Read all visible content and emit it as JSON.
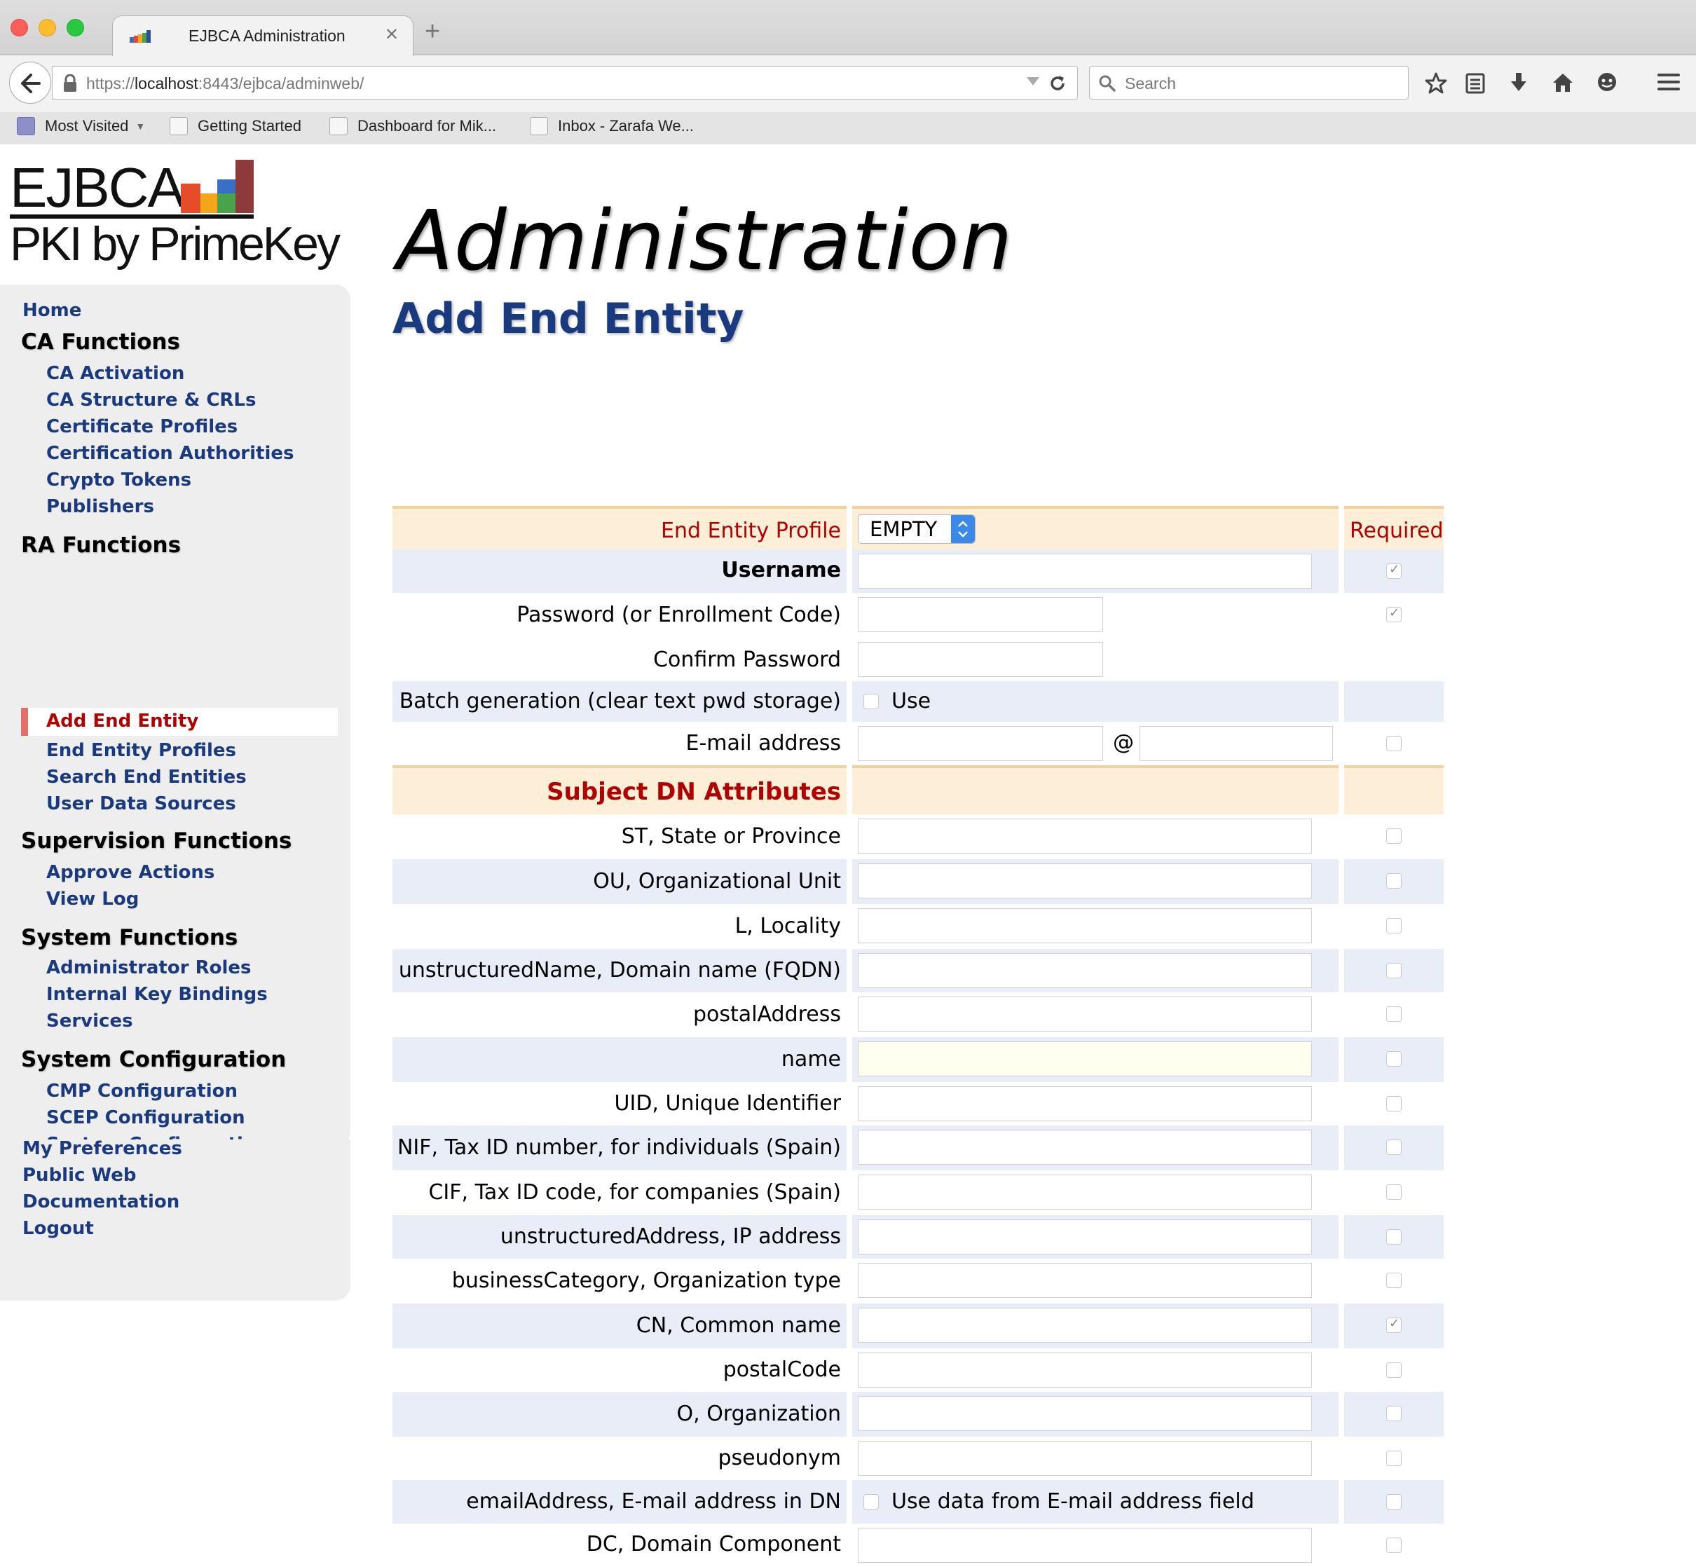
{
  "browser": {
    "tab_title": "EJBCA Administration",
    "url_scheme": "https://",
    "url_host": "localhost",
    "url_rest": ":8443/ejbca/adminweb/",
    "search_placeholder": "Search",
    "bookmarks": [
      "Most Visited",
      "Getting Started",
      "Dashboard for Mik...",
      "Inbox - Zarafa We..."
    ]
  },
  "logo": {
    "line1": "EJBCA",
    "line2": "PKI by PrimeKey"
  },
  "header": {
    "title": "Administration"
  },
  "sidebar": {
    "home": "Home",
    "ca_functions": {
      "title": "CA Functions",
      "items": [
        "CA Activation",
        "CA Structure & CRLs",
        "Certificate Profiles",
        "Certification Authorities",
        "Crypto Tokens",
        "Publishers"
      ]
    },
    "ra_functions": {
      "title": "RA Functions",
      "items": [
        "Add End Entity",
        "End Entity Profiles",
        "Search End Entities",
        "User Data Sources"
      ]
    },
    "supervision_functions": {
      "title": "Supervision Functions",
      "items": [
        "Approve Actions",
        "View Log"
      ]
    },
    "system_functions": {
      "title": "System Functions",
      "items": [
        "Administrator Roles",
        "Internal Key Bindings",
        "Services"
      ]
    },
    "system_configuration": {
      "title": "System Configuration",
      "items": [
        "CMP Configuration",
        "SCEP Configuration",
        "System Configuration"
      ]
    },
    "bottom": [
      "My Preferences",
      "Public Web",
      "Documentation",
      "Logout"
    ]
  },
  "main": {
    "section_title": "Add End Entity",
    "profile_label": "End Entity Profile",
    "profile_value": "EMPTY",
    "required_label": "Required",
    "username": "Username",
    "password": "Password (or Enrollment Code)",
    "confirm_password": "Confirm Password",
    "batch": "Batch generation (clear text pwd storage)",
    "batch_use": "Use",
    "email": "E-mail address",
    "at": "@",
    "subject_dn": "Subject DN Attributes",
    "dn_fields": [
      "ST, State or Province",
      "OU, Organizational Unit",
      "L, Locality",
      "unstructuredName, Domain name (FQDN)",
      "postalAddress",
      "name",
      "UID, Unique Identifier",
      "NIF, Tax ID number, for individuals (Spain)",
      "CIF, Tax ID code, for companies (Spain)",
      "unstructuredAddress, IP address",
      "businessCategory, Organization type",
      "CN, Common name",
      "postalCode",
      "O, Organization",
      "pseudonym",
      "emailAddress, E-mail address in DN",
      "DC, Domain Component"
    ],
    "email_in_dn_use": "Use data from E-mail address field"
  }
}
